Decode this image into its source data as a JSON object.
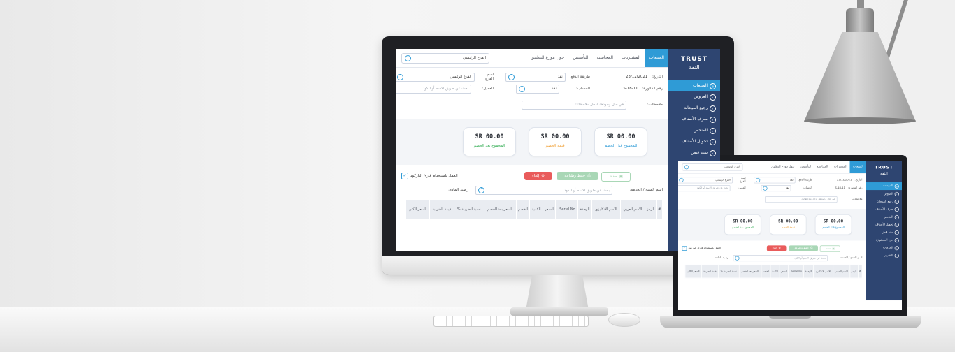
{
  "brand": {
    "en": "TRUST",
    "ar": "الثقة"
  },
  "sidebar": {
    "items": [
      {
        "label": "المبيعات",
        "icon": "sales-icon",
        "active": true
      },
      {
        "label": "العروض",
        "icon": "offers-icon"
      },
      {
        "label": "رجيع المبيعات",
        "icon": "returns-icon"
      },
      {
        "label": "صرف الأصناف",
        "icon": "issue-icon"
      },
      {
        "label": "المنحص",
        "icon": "filter-icon"
      },
      {
        "label": "تحويل الأصناف",
        "icon": "transfer-icon"
      },
      {
        "label": "سند قبض",
        "icon": "receipt-icon"
      }
    ],
    "laptop_extra": [
      {
        "label": "جرد المستودع",
        "icon": "inventory-icon"
      },
      {
        "label": "الخدمات",
        "icon": "services-icon"
      },
      {
        "label": "التقارير",
        "icon": "reports-icon"
      }
    ]
  },
  "topnav": {
    "tabs": [
      "المبيعات",
      "المشتريات",
      "المحاسبة",
      "التأسيس",
      "حول موزع التطبيق"
    ],
    "branch_value": "الفرع الرئيسي"
  },
  "form": {
    "date_label": "التاريخ:",
    "date_value": "23/12/2021",
    "invoice_label": "رقم الفاتورة:",
    "invoice_value": "S-18-11",
    "payment_label": "طريقة الدفع:",
    "payment_value": "نقد",
    "account_label": "الحساب:",
    "account_value": "نقد",
    "branch_label": "اسم الفرع",
    "branch_value": "الفرع الرئيسي",
    "customer_label": "العميل:",
    "customer_placeholder": "بحث عن طريق الاسم أو الكود",
    "notes_label": "ملاحظات:",
    "notes_placeholder": "في حال وجودها، ادخل ملاحظاتك"
  },
  "totals": [
    {
      "value": "00.00 SR",
      "label": "المجموع قبل الخصم",
      "color": "#2f9bd6"
    },
    {
      "value": "00.00 SR",
      "label": "قيمة الخصم",
      "color": "#f0a23a"
    },
    {
      "value": "00.00 SR",
      "label": "المجموع بعد الخصم",
      "color": "#3db15c"
    }
  ],
  "actions": {
    "save": "حفظ",
    "save_print": "حفظ وطباعة",
    "cancel": "إلغاء",
    "barcode_label": "العمل باستخدام قارئ الباركود"
  },
  "search": {
    "item_label": "اسم المنتج / الخدمة:",
    "item_placeholder": "بحث عن طريق الاسم أو الكود",
    "balance_label": "رصيد المادة:"
  },
  "table": {
    "headers": [
      "#",
      "الرمز",
      "الاسم العربي",
      "الاسم الانكليزي",
      "الوحدة",
      "Serial No.",
      "السعر",
      "الكمية",
      "الخصم",
      "السعر بعد الخصم",
      "نسبة الضريبة %",
      "قيمة الضريبة",
      "السعر الكلي"
    ]
  },
  "colors": {
    "sidebar": "#2e4571",
    "accent": "#2f9bd6",
    "cancel": "#e95b5b",
    "save_print": "#3db15c",
    "save_disabled": "#a9d7b6"
  }
}
